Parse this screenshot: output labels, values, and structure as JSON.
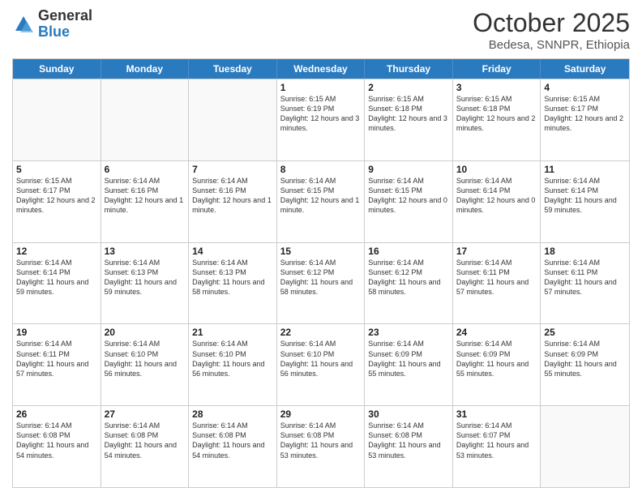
{
  "logo": {
    "general": "General",
    "blue": "Blue"
  },
  "header": {
    "title": "October 2025",
    "subtitle": "Bedesa, SNNPR, Ethiopia"
  },
  "weekdays": [
    "Sunday",
    "Monday",
    "Tuesday",
    "Wednesday",
    "Thursday",
    "Friday",
    "Saturday"
  ],
  "rows": [
    [
      {
        "day": "",
        "empty": true
      },
      {
        "day": "",
        "empty": true
      },
      {
        "day": "",
        "empty": true
      },
      {
        "day": "1",
        "sunrise": "Sunrise: 6:15 AM",
        "sunset": "Sunset: 6:19 PM",
        "daylight": "Daylight: 12 hours and 3 minutes."
      },
      {
        "day": "2",
        "sunrise": "Sunrise: 6:15 AM",
        "sunset": "Sunset: 6:18 PM",
        "daylight": "Daylight: 12 hours and 3 minutes."
      },
      {
        "day": "3",
        "sunrise": "Sunrise: 6:15 AM",
        "sunset": "Sunset: 6:18 PM",
        "daylight": "Daylight: 12 hours and 2 minutes."
      },
      {
        "day": "4",
        "sunrise": "Sunrise: 6:15 AM",
        "sunset": "Sunset: 6:17 PM",
        "daylight": "Daylight: 12 hours and 2 minutes."
      }
    ],
    [
      {
        "day": "5",
        "sunrise": "Sunrise: 6:15 AM",
        "sunset": "Sunset: 6:17 PM",
        "daylight": "Daylight: 12 hours and 2 minutes."
      },
      {
        "day": "6",
        "sunrise": "Sunrise: 6:14 AM",
        "sunset": "Sunset: 6:16 PM",
        "daylight": "Daylight: 12 hours and 1 minute."
      },
      {
        "day": "7",
        "sunrise": "Sunrise: 6:14 AM",
        "sunset": "Sunset: 6:16 PM",
        "daylight": "Daylight: 12 hours and 1 minute."
      },
      {
        "day": "8",
        "sunrise": "Sunrise: 6:14 AM",
        "sunset": "Sunset: 6:15 PM",
        "daylight": "Daylight: 12 hours and 1 minute."
      },
      {
        "day": "9",
        "sunrise": "Sunrise: 6:14 AM",
        "sunset": "Sunset: 6:15 PM",
        "daylight": "Daylight: 12 hours and 0 minutes."
      },
      {
        "day": "10",
        "sunrise": "Sunrise: 6:14 AM",
        "sunset": "Sunset: 6:14 PM",
        "daylight": "Daylight: 12 hours and 0 minutes."
      },
      {
        "day": "11",
        "sunrise": "Sunrise: 6:14 AM",
        "sunset": "Sunset: 6:14 PM",
        "daylight": "Daylight: 11 hours and 59 minutes."
      }
    ],
    [
      {
        "day": "12",
        "sunrise": "Sunrise: 6:14 AM",
        "sunset": "Sunset: 6:14 PM",
        "daylight": "Daylight: 11 hours and 59 minutes."
      },
      {
        "day": "13",
        "sunrise": "Sunrise: 6:14 AM",
        "sunset": "Sunset: 6:13 PM",
        "daylight": "Daylight: 11 hours and 59 minutes."
      },
      {
        "day": "14",
        "sunrise": "Sunrise: 6:14 AM",
        "sunset": "Sunset: 6:13 PM",
        "daylight": "Daylight: 11 hours and 58 minutes."
      },
      {
        "day": "15",
        "sunrise": "Sunrise: 6:14 AM",
        "sunset": "Sunset: 6:12 PM",
        "daylight": "Daylight: 11 hours and 58 minutes."
      },
      {
        "day": "16",
        "sunrise": "Sunrise: 6:14 AM",
        "sunset": "Sunset: 6:12 PM",
        "daylight": "Daylight: 11 hours and 58 minutes."
      },
      {
        "day": "17",
        "sunrise": "Sunrise: 6:14 AM",
        "sunset": "Sunset: 6:11 PM",
        "daylight": "Daylight: 11 hours and 57 minutes."
      },
      {
        "day": "18",
        "sunrise": "Sunrise: 6:14 AM",
        "sunset": "Sunset: 6:11 PM",
        "daylight": "Daylight: 11 hours and 57 minutes."
      }
    ],
    [
      {
        "day": "19",
        "sunrise": "Sunrise: 6:14 AM",
        "sunset": "Sunset: 6:11 PM",
        "daylight": "Daylight: 11 hours and 57 minutes."
      },
      {
        "day": "20",
        "sunrise": "Sunrise: 6:14 AM",
        "sunset": "Sunset: 6:10 PM",
        "daylight": "Daylight: 11 hours and 56 minutes."
      },
      {
        "day": "21",
        "sunrise": "Sunrise: 6:14 AM",
        "sunset": "Sunset: 6:10 PM",
        "daylight": "Daylight: 11 hours and 56 minutes."
      },
      {
        "day": "22",
        "sunrise": "Sunrise: 6:14 AM",
        "sunset": "Sunset: 6:10 PM",
        "daylight": "Daylight: 11 hours and 56 minutes."
      },
      {
        "day": "23",
        "sunrise": "Sunrise: 6:14 AM",
        "sunset": "Sunset: 6:09 PM",
        "daylight": "Daylight: 11 hours and 55 minutes."
      },
      {
        "day": "24",
        "sunrise": "Sunrise: 6:14 AM",
        "sunset": "Sunset: 6:09 PM",
        "daylight": "Daylight: 11 hours and 55 minutes."
      },
      {
        "day": "25",
        "sunrise": "Sunrise: 6:14 AM",
        "sunset": "Sunset: 6:09 PM",
        "daylight": "Daylight: 11 hours and 55 minutes."
      }
    ],
    [
      {
        "day": "26",
        "sunrise": "Sunrise: 6:14 AM",
        "sunset": "Sunset: 6:08 PM",
        "daylight": "Daylight: 11 hours and 54 minutes."
      },
      {
        "day": "27",
        "sunrise": "Sunrise: 6:14 AM",
        "sunset": "Sunset: 6:08 PM",
        "daylight": "Daylight: 11 hours and 54 minutes."
      },
      {
        "day": "28",
        "sunrise": "Sunrise: 6:14 AM",
        "sunset": "Sunset: 6:08 PM",
        "daylight": "Daylight: 11 hours and 54 minutes."
      },
      {
        "day": "29",
        "sunrise": "Sunrise: 6:14 AM",
        "sunset": "Sunset: 6:08 PM",
        "daylight": "Daylight: 11 hours and 53 minutes."
      },
      {
        "day": "30",
        "sunrise": "Sunrise: 6:14 AM",
        "sunset": "Sunset: 6:08 PM",
        "daylight": "Daylight: 11 hours and 53 minutes."
      },
      {
        "day": "31",
        "sunrise": "Sunrise: 6:14 AM",
        "sunset": "Sunset: 6:07 PM",
        "daylight": "Daylight: 11 hours and 53 minutes."
      },
      {
        "day": "",
        "empty": true
      }
    ]
  ]
}
